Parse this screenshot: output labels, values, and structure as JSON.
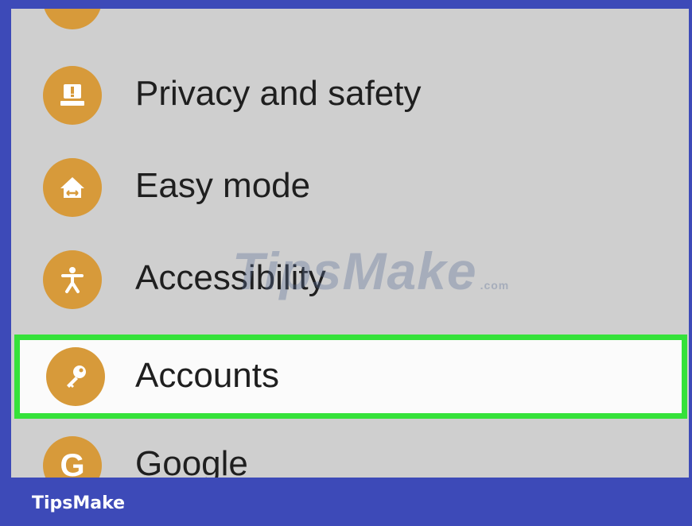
{
  "settings": {
    "items": [
      {
        "label": "Privacy and safety",
        "icon": "privacy-icon"
      },
      {
        "label": "Easy mode",
        "icon": "easy-mode-icon"
      },
      {
        "label": "Accessibility",
        "icon": "accessibility-icon"
      },
      {
        "label": "Accounts",
        "icon": "key-icon",
        "highlighted": true
      },
      {
        "label": "Google",
        "icon": "google-icon",
        "glyph": "G"
      }
    ]
  },
  "watermark": {
    "text": "TipsMake",
    "suffix": ".com"
  },
  "footer": {
    "brand": "TipsMake"
  },
  "colors": {
    "frame": "#3d4ab8",
    "icon": "#d79a3a",
    "highlight_border": "#35e23a",
    "background": "#cfcfcf"
  }
}
